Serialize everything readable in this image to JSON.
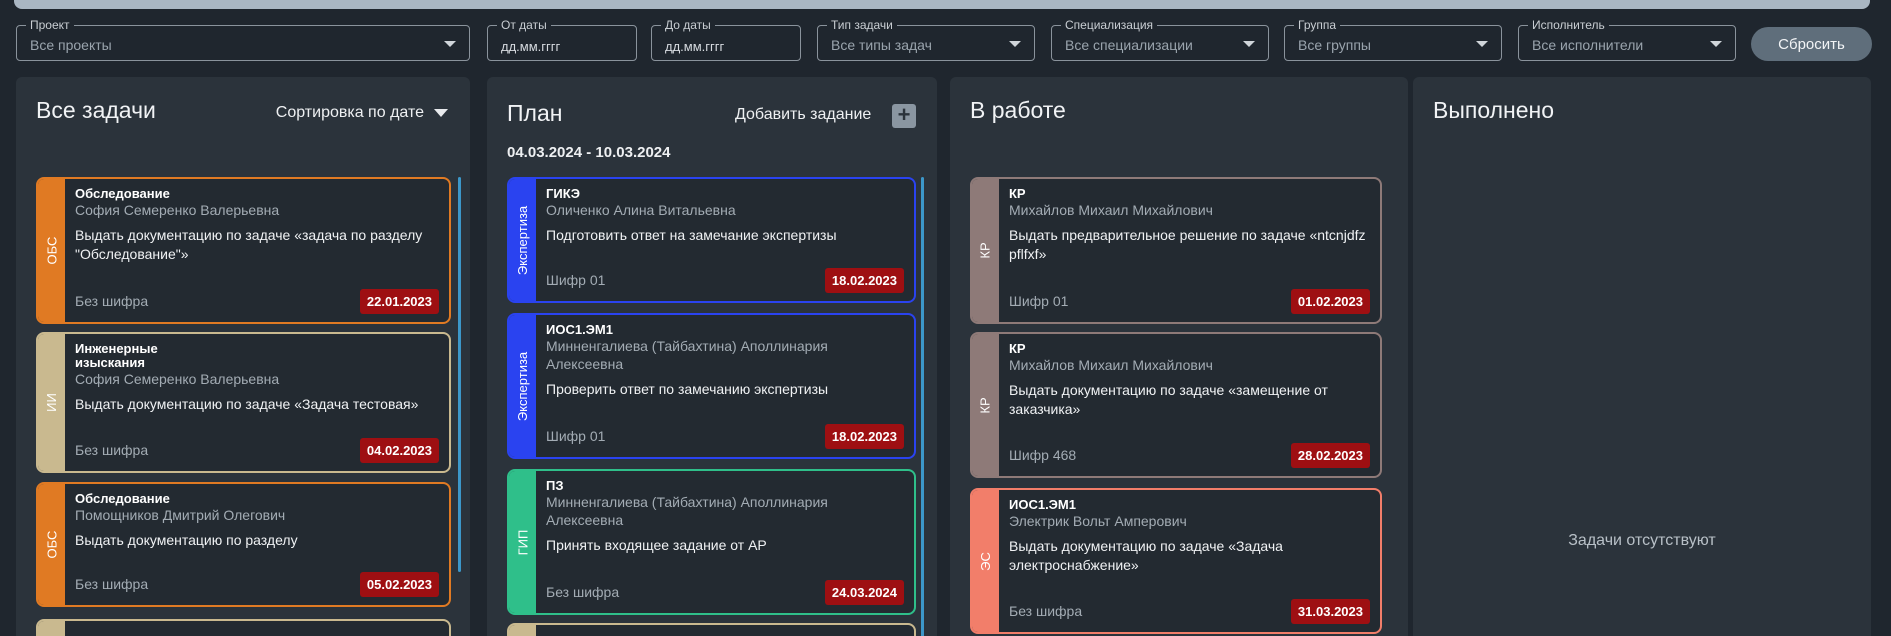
{
  "filters": {
    "project": {
      "label": "Проект",
      "value": "Все проекты"
    },
    "date_from": {
      "label": "От даты",
      "value": "дд.мм.гггг"
    },
    "date_to": {
      "label": "До даты",
      "value": "дд.мм.гггг"
    },
    "task_type": {
      "label": "Тип задачи",
      "value": "Все типы задач"
    },
    "specialization": {
      "label": "Специализация",
      "value": "Все специализации"
    },
    "group": {
      "label": "Группа",
      "value": "Все группы"
    },
    "executor": {
      "label": "Исполнитель",
      "value": "Все исполнители"
    },
    "reset_label": "Сбросить"
  },
  "columns": {
    "all": {
      "title": "Все задачи",
      "sort_label": "Сортировка по дате",
      "cards": [
        {
          "tag": "ОБС",
          "title": "Обследование",
          "person": "София Семеренко Валерьевна",
          "desc": "Выдать документацию по задаче «задача по разделу \"Обследование\"»",
          "cipher": "Без шифра",
          "date": "22.01.2023"
        },
        {
          "tag": "ИИ",
          "title": "Инженерные изыскания",
          "person": "София Семеренко Валерьевна",
          "desc": "Выдать документацию по задаче «Задача тестовая»",
          "cipher": "Без шифра",
          "date": "04.02.2023"
        },
        {
          "tag": "ОБС",
          "title": "Обследование",
          "person": "Помощников Дмитрий Олегович",
          "desc": "Выдать документацию по разделу",
          "cipher": "Без шифра",
          "date": "05.02.2023"
        }
      ]
    },
    "plan": {
      "title": "План",
      "add_label": "Добавить задание",
      "add_icon": "+",
      "date_range": "04.03.2024 - 10.03.2024",
      "cards": [
        {
          "tag": "Экспертиза",
          "title": "ГИКЭ",
          "person": "Оличенко Алина Витальевна",
          "desc": "Подготовить ответ на замечание экспертизы",
          "cipher": "Шифр 01",
          "date": "18.02.2023"
        },
        {
          "tag": "Экспертиза",
          "title": "ИОС1.ЭМ1",
          "person": "Минненгалиева (Тайбахтина) Аполлинария Алексеевна",
          "desc": "Проверить ответ по замечанию экспертизы",
          "cipher": "Шифр 01",
          "date": "18.02.2023"
        },
        {
          "tag": "ГИП",
          "title": "ПЗ",
          "person": "Минненгалиева (Тайбахтина) Аполлинария Алексеевна",
          "desc": "Принять входящее задание от АР",
          "cipher": "Без шифра",
          "date": "24.03.2024"
        }
      ]
    },
    "work": {
      "title": "В работе",
      "cards": [
        {
          "tag": "КР",
          "title": "КР",
          "person": "Михайлов Михаил Михайлович",
          "desc": "Выдать предварительное решение по задаче «ntcnjdfz pflfxf»",
          "cipher": "Шифр 01",
          "date": "01.02.2023"
        },
        {
          "tag": "КР",
          "title": "КР",
          "person": "Михайлов Михаил Михайлович",
          "desc": "Выдать документацию по задаче «замещение от заказчика»",
          "cipher": "Шифр 468",
          "date": "28.02.2023"
        },
        {
          "tag": "ЭС",
          "title": "ИОС1.ЭМ1",
          "person": "Электрик Вольт Амперович",
          "desc": "Выдать документацию по задаче «Задача электроснабжение»",
          "cipher": "Без шифра",
          "date": "31.03.2023"
        }
      ]
    },
    "done": {
      "title": "Выполнено",
      "empty": "Задачи отсутствуют"
    }
  },
  "colors": {
    "obs": "#e07a23",
    "ii": "#c9b98f",
    "expertise": "#2a43f0",
    "gip": "#2fbf8a",
    "kr": "#8e7a78",
    "es": "#f27e6a",
    "date_badge": "#9e0f12",
    "scroll": "#3c97c9"
  }
}
